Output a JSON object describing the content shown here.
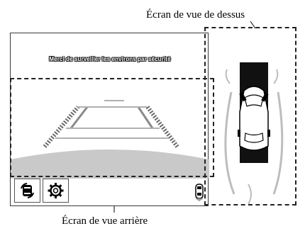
{
  "callouts": {
    "top_view": "Écran de vue de dessus",
    "rear_view": "Écran de vue arrière"
  },
  "screen": {
    "notice": "Merci de surveiller les environs par sécurité"
  },
  "icons": {
    "camera_switch": "camera-switch-icon",
    "settings": "gear-icon",
    "car": "car-icon"
  },
  "colors": {
    "ground": "#c9c9c9",
    "guide_lines": "#666666",
    "overhead_strip": "#111111"
  }
}
